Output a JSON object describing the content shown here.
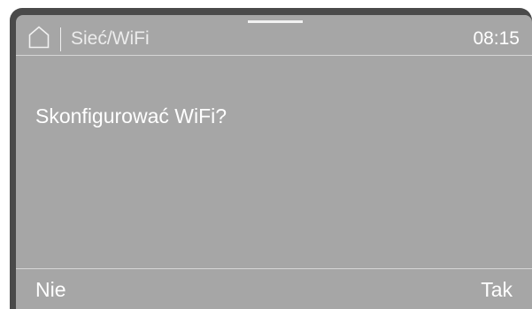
{
  "header": {
    "home_icon": "home-icon",
    "title": "Sieć/WiFi",
    "time": "08:15"
  },
  "dialog": {
    "question": "Skonfigurować WiFi?"
  },
  "footer": {
    "left_label": "Nie",
    "right_label": "Tak"
  },
  "colors": {
    "screen_background": "#a6a6a6",
    "frame": "#4a4a4a",
    "text": "#ffffff"
  }
}
